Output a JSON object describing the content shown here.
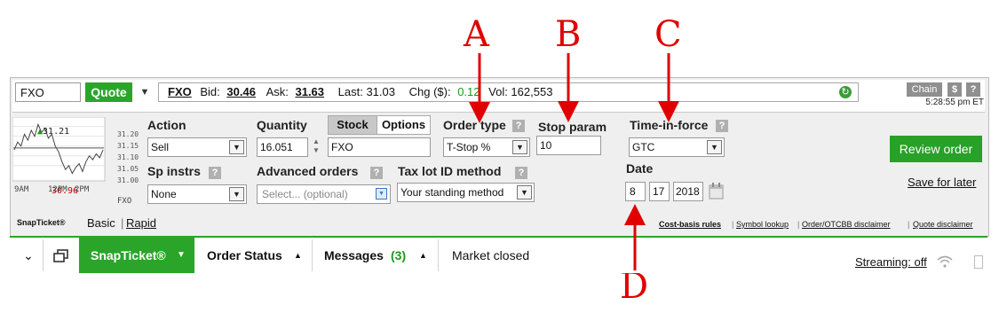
{
  "annotations": [
    "A",
    "B",
    "C",
    "D"
  ],
  "quote_bar": {
    "symbol": "FXO",
    "quote_button": "Quote",
    "strip_symbol": "FXO",
    "bid_label": "Bid:",
    "bid": "30.46",
    "ask_label": "Ask:",
    "ask": "31.63",
    "last": "Last: 31.03",
    "chg_label": "Chg ($):",
    "chg": "0.12",
    "vol": "Vol: 162,553",
    "chain_button": "Chain",
    "dollar_button": "$",
    "help_button": "?",
    "time": "5:28:55 pm ET"
  },
  "chart": {
    "high_label": "31.21",
    "low_label": "30.96",
    "y_ticks": [
      "31.20",
      "31.15",
      "31.10",
      "31.05",
      "31.00"
    ],
    "x_ticks": [
      "9AM",
      "12PM",
      "2PM"
    ],
    "symbol": "FXO",
    "prices": [
      31.08,
      31.12,
      31.1,
      31.16,
      31.13,
      31.18,
      31.15,
      31.21,
      31.17,
      31.19,
      31.14,
      31.16,
      31.1,
      31.07,
      31.02,
      30.98,
      31.0,
      30.96,
      30.99,
      31.01,
      30.97,
      31.02,
      31.05,
      31.03,
      31.06,
      31.04,
      31.08
    ],
    "prev_close": 31.09
  },
  "form": {
    "action_label": "Action",
    "action_value": "Sell",
    "quantity_label": "Quantity",
    "quantity_value": "16.051",
    "stock_tab": "Stock",
    "options_tab": "Options",
    "symbol_value": "FXO",
    "order_type_label": "Order type",
    "order_type_value": "T-Stop %",
    "stop_param_label": "Stop param",
    "stop_param_value": "10",
    "tif_label": "Time-in-force",
    "tif_value": "GTC",
    "date_label": "Date",
    "date_month": "8",
    "date_day": "17",
    "date_year": "2018",
    "sp_instrs_label": "Sp instrs",
    "sp_instrs_value": "None",
    "advanced_label": "Advanced orders",
    "advanced_placeholder": "Select... (optional)",
    "taxlot_label": "Tax lot ID method",
    "taxlot_value": "Your standing method",
    "help_glyph": "?",
    "review_button": "Review order",
    "save_link": "Save for later"
  },
  "footer": {
    "snapticket_brand": "SnapTicket®",
    "basic": "Basic",
    "sep": "|",
    "rapid": "Rapid",
    "links": [
      "Cost-basis rules",
      "Symbol lookup",
      "Order/OTCBB disclaimer",
      "Quote disclaimer"
    ]
  },
  "taskbar": {
    "snapticket_tab": "SnapTicket®",
    "order_status": "Order Status",
    "messages": "Messages",
    "messages_count": "(3)",
    "market_status": "Market closed",
    "streaming": "Streaming: off"
  }
}
